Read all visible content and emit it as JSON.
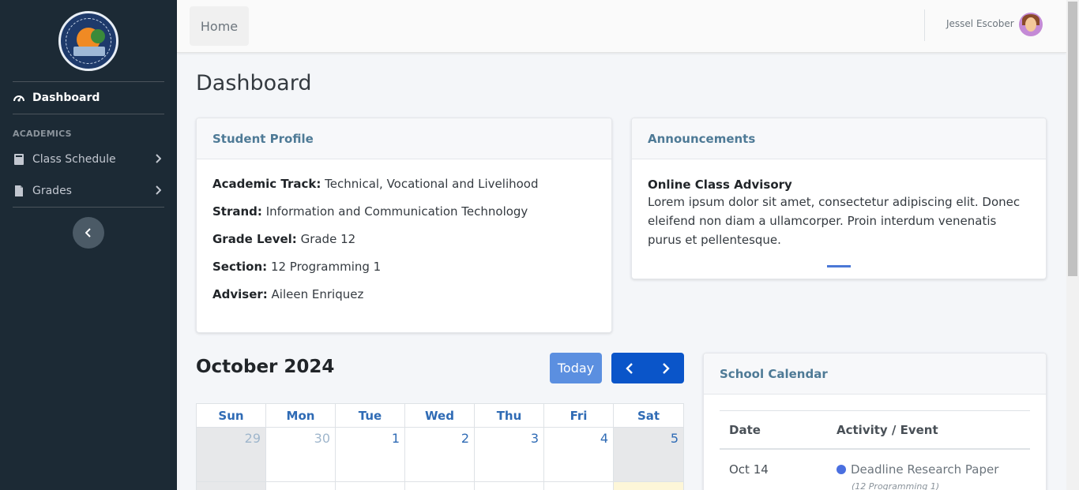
{
  "sidebar": {
    "items": [
      {
        "label": "Dashboard",
        "icon": "tachometer-icon"
      },
      {
        "label": "Class Schedule",
        "icon": "book-icon"
      },
      {
        "label": "Grades",
        "icon": "document-icon"
      }
    ],
    "section_header": "ACADEMICS",
    "collapse_icon": "chevron-left-icon"
  },
  "navbar": {
    "home_label": "Home",
    "user_name": "Jessel Escober"
  },
  "page": {
    "title": "Dashboard"
  },
  "profile": {
    "title": "Student Profile",
    "rows": [
      {
        "label": "Academic Track:",
        "value": "Technical, Vocational and Livelihood"
      },
      {
        "label": "Strand:",
        "value": "Information and Communication Technology"
      },
      {
        "label": "Grade Level:",
        "value": "Grade 12"
      },
      {
        "label": "Section:",
        "value": "12 Programming 1"
      },
      {
        "label": "Adviser:",
        "value": "Aileen Enriquez"
      }
    ]
  },
  "announcements": {
    "title": "Announcements",
    "item_title": "Online Class Advisory",
    "item_body": "Lorem ipsum dolor sit amet, consectetur adipiscing elit. Donec eleifend non diam a ullamcorper. Proin interdum venenatis purus et pellentesque."
  },
  "calendar": {
    "month_label": "October 2024",
    "today_label": "Today",
    "weekdays": [
      "Sun",
      "Mon",
      "Tue",
      "Wed",
      "Thu",
      "Fri",
      "Sat"
    ],
    "week1": [
      "29",
      "30",
      "1",
      "2",
      "3",
      "4",
      "5"
    ]
  },
  "school_calendar": {
    "title": "School Calendar",
    "col_date": "Date",
    "col_event": "Activity / Event",
    "rows": [
      {
        "date": "Oct 14",
        "event": "Deadline Research Paper",
        "sub": "(12 Programming 1)"
      }
    ]
  },
  "colors": {
    "sidebar_bg": "#1c2a35",
    "accent": "#0a55c9",
    "header_text": "#4e7a96"
  }
}
